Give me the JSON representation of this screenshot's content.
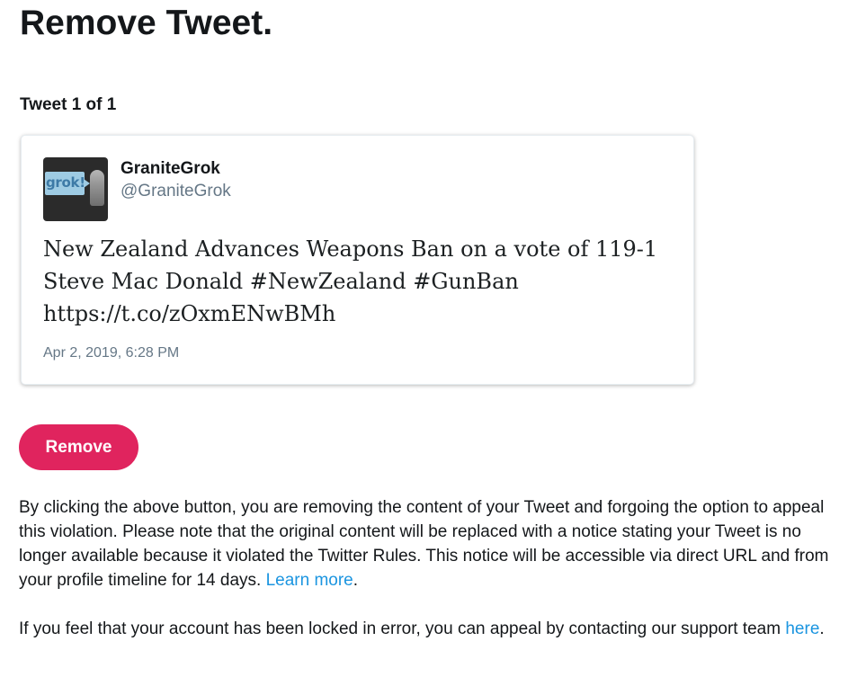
{
  "page": {
    "title": "Remove Tweet.",
    "counter": "Tweet 1 of 1"
  },
  "tweet": {
    "avatar_text": "grok!",
    "author_name": "GraniteGrok",
    "author_handle": "@GraniteGrok",
    "text_lines": [
      "New Zealand Advances Weapons Ban on a vote of 119-1",
      "Steve Mac Donald #NewZealand #GunBan",
      "https://t.co/zOxmENwBMh"
    ],
    "timestamp": "Apr 2, 2019, 6:28 PM"
  },
  "actions": {
    "remove_label": "Remove"
  },
  "notice": {
    "text": "By clicking the above button, you are removing the content of your Tweet and forgoing the option to appeal this violation. Please note that the original content will be replaced with a notice stating your Tweet is no longer available because it violated the Twitter Rules. This notice will be accessible via direct URL and from your profile timeline for 14 days.",
    "learn_more": "Learn more",
    "end_punct": "."
  },
  "appeal": {
    "text": "If you feel that your account has been locked in error, you can appeal by contacting our support team",
    "link": "here",
    "end_punct": "."
  },
  "colors": {
    "accent": "#e0245e",
    "link": "#1b95e0",
    "muted": "#657786"
  }
}
